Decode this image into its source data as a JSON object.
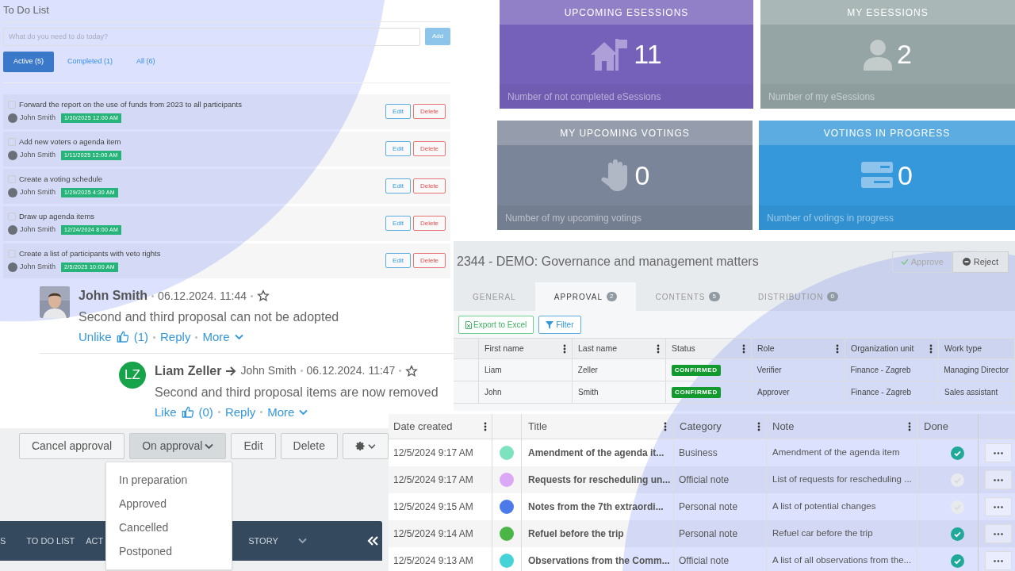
{
  "todo": {
    "title": "To Do List",
    "placeholder": "What do you need to do today?",
    "add": "Add",
    "tabs": [
      {
        "label": "Active (5)",
        "selected": true
      },
      {
        "label": "Completed (1)",
        "selected": false
      },
      {
        "label": "All (6)",
        "selected": false
      }
    ],
    "items": [
      {
        "title": "Forward the report on the use of funds from 2023 to all participants",
        "user": "John Smith",
        "due": "1/30/2025 12:00 AM",
        "checked": false,
        "edit": "Edit",
        "delete": "Delete"
      },
      {
        "title": "Add new voters o agenda item",
        "user": "John Smith",
        "due": "1/11/2025 12:00 AM",
        "checked": false,
        "edit": "Edit",
        "delete": "Delete"
      },
      {
        "title": "Create a voting schedule",
        "user": "John Smith",
        "due": "1/29/2025 4:30 AM",
        "checked": false,
        "edit": "Edit",
        "delete": "Delete"
      },
      {
        "title": "Draw up agenda items",
        "user": "John Smith",
        "due": "12/24/2024 8:00 AM",
        "checked": false,
        "edit": "Edit",
        "delete": "Delete"
      },
      {
        "title": "Create a list of participants with veto rights",
        "user": "John Smith",
        "due": "2/5/2025 10:00 AM",
        "checked": false,
        "edit": "Edit",
        "delete": "Delete"
      }
    ]
  },
  "comments": [
    {
      "author": "John Smith",
      "time": "06.12.2024. 11:44",
      "text": "Second and third proposal can not be adopted",
      "like": "Unlike",
      "likes": "(1)",
      "reply": "Reply",
      "more": "More"
    },
    {
      "initials": "LZ",
      "author": "Liam Zeller",
      "to": "John Smith",
      "time": "06.12.2024. 11:47",
      "text": "Second and third proposal items are now removed",
      "like": "Like",
      "likes": "(0)",
      "reply": "Reply",
      "more": "More"
    }
  ],
  "actions": {
    "buttons": [
      {
        "label": "Cancel approval",
        "kind": "plain",
        "selected": false
      },
      {
        "label": "On approval",
        "kind": "dropdown",
        "selected": true
      },
      {
        "label": "Edit",
        "kind": "plain",
        "selected": false
      },
      {
        "label": "Delete",
        "kind": "plain",
        "selected": false
      },
      {
        "kind": "gear",
        "selected": false
      }
    ],
    "menu": [
      "In preparation",
      "Approved",
      "Cancelled",
      "Postponed"
    ],
    "nav": [
      "S",
      "TO DO LIST",
      "ACT",
      "STORY"
    ]
  },
  "tiles": [
    {
      "title": "UPCOMING ESESSIONS",
      "value": "11",
      "footer": "Number of not completed eSessions",
      "color": "#7661ba"
    },
    {
      "title": "MY ESESSIONS",
      "value": "2",
      "footer": "Number of my eSessions",
      "color": "#95a5a6"
    },
    {
      "title": "MY UPCOMING VOTINGS",
      "value": "0",
      "footer": "Number of my upcoming votings",
      "color": "#7b8599"
    },
    {
      "title": "VOTINGS IN PROGRESS",
      "value": "0",
      "footer": "Number of votings in progress",
      "color": "#3498db"
    }
  ],
  "document": {
    "title": "2344 - DEMO: Governance and management matters",
    "approve": "Approve",
    "reject": "Reject",
    "tabs": [
      {
        "label": "GENERAL",
        "selected": false
      },
      {
        "label": "APPROVAL",
        "count": "2",
        "selected": true
      },
      {
        "label": "CONTENTS",
        "count": "5",
        "selected": false
      },
      {
        "label": "DISTRIBUTION",
        "count": "0",
        "selected": false
      }
    ],
    "export": "Export to Excel",
    "filter": "Filter",
    "columns": [
      "First name",
      "Last name",
      "Status",
      "Role",
      "Organization unit",
      "Work type"
    ],
    "rows": [
      [
        "Liam",
        "Zeller",
        "CONFIRMED",
        "Verifier",
        "Finance - Zagreb",
        "Managing Director"
      ],
      [
        "John",
        "Smith",
        "CONFIRMED",
        "Approver",
        "Finance - Zagreb",
        "Sales assistant"
      ]
    ]
  },
  "notes": {
    "columns": [
      "Date created",
      "Title",
      "Category",
      "Note",
      "Done"
    ],
    "rows": [
      {
        "date": "12/5/2024 9:17 AM",
        "color": "#7de3be",
        "title": "Amendment of the agenda it...",
        "category": "Business",
        "note": "Amendment of the agenda item",
        "done": true
      },
      {
        "date": "12/5/2024 9:17 AM",
        "color": "#dba8f5",
        "title": "Requests for rescheduling un...",
        "category": "Official note",
        "note": "List of requests for rescheduling ...",
        "done": false
      },
      {
        "date": "12/5/2024 9:15 AM",
        "color": "#4c7ae8",
        "title": "Notes from the 7th extraordi...",
        "category": "Personal note",
        "note": "A list of potential changes",
        "done": false
      },
      {
        "date": "12/5/2024 9:14 AM",
        "color": "#4cb548",
        "title": "Refuel before the trip",
        "category": "Personal note",
        "note": "Refuel car before the trip",
        "done": true
      },
      {
        "date": "12/5/2024 9:13 AM",
        "color": "#45d3d8",
        "title": "Observations from the Comm...",
        "category": "Official note",
        "note": "A list of all observations from the...",
        "done": true
      }
    ]
  }
}
